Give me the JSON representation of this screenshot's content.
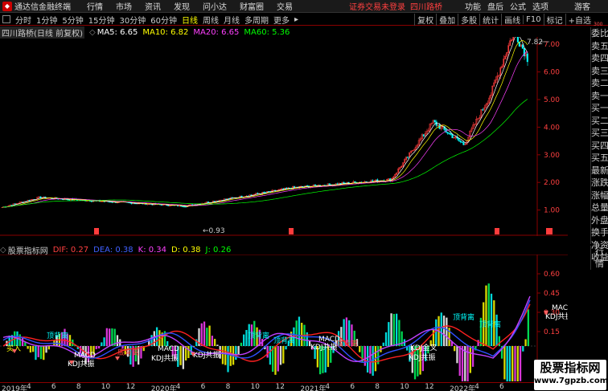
{
  "menubar": {
    "app_title": "通达信金融终端",
    "items": [
      "行情",
      "市场",
      "资讯",
      "发现",
      "问小达",
      "财富圈",
      "交易"
    ],
    "login_warning": "证券交易未登录",
    "stock_name": "四川路桥",
    "right_items": [
      "功能",
      "盘后",
      "公式",
      "选项"
    ],
    "guest": "游客"
  },
  "toolbar": {
    "periods": [
      "分时",
      "1分钟",
      "5分钟",
      "15分钟",
      "30分钟",
      "60分钟",
      "日线",
      "周线",
      "月线",
      "多周期",
      "更多"
    ],
    "active_period": "日线",
    "right_tools": [
      "复权",
      "叠加",
      "多股",
      "统计",
      "画线",
      "F10",
      "标记",
      "+自选"
    ]
  },
  "main_header": {
    "stock_label": "四川路桥(日线 前复权)",
    "ma5": "MA5: 6.65",
    "ma10": "MA10: 6.82",
    "ma20": "MA20: 6.65",
    "ma60": "MA60: 5.36"
  },
  "sub_header": {
    "indicator_name": "股票指标网",
    "dif": "DIF: 0.27",
    "dea": "DEA: 0.38",
    "k": "K: 0.34",
    "d": "D: 0.38",
    "j": "J: 0.26"
  },
  "right_tabs": [
    "委比",
    "卖五",
    "卖四",
    "卖三",
    "卖二",
    "卖一",
    "买一",
    "买二",
    "买三",
    "买四",
    "买五",
    "最新",
    "涨跌",
    "涨幅",
    "总量",
    "外盘",
    "换手",
    "净资",
    "收益"
  ],
  "right_tabs2": [
    "行情"
  ],
  "tiny_top": "300",
  "price_axis": [
    "7.00",
    "6.00",
    "5.00",
    "4.00",
    "3.00",
    "2.00",
    "1.00"
  ],
  "sub_axis": [
    "0.60",
    "0.45",
    "0.30",
    "0.15"
  ],
  "annotations": {
    "high": "7.82",
    "low": "0.93",
    "divergence": "顶背离",
    "bottom_divergence": "底背离",
    "macd": "MACD",
    "kdj": "KDJ共振",
    "buy": "买入",
    "kdj_cross": "KDJ金叉"
  },
  "dates": [
    "2019年",
    "4",
    "6",
    "8",
    "10",
    "12",
    "2020年",
    "4",
    "6",
    "8",
    "10",
    "12",
    "2021年",
    "4",
    "6",
    "8",
    "10",
    "12",
    "2022年",
    "4",
    "6"
  ],
  "watermark": {
    "line1": "股票指标网",
    "line2": "www.7gpzb.com"
  },
  "colors": {
    "up": "#ff3c3c",
    "down": "#00ffff",
    "ma5": "#ffffff",
    "ma10": "#ffff00",
    "ma20": "#ff40ff",
    "ma60": "#00ff00"
  }
}
